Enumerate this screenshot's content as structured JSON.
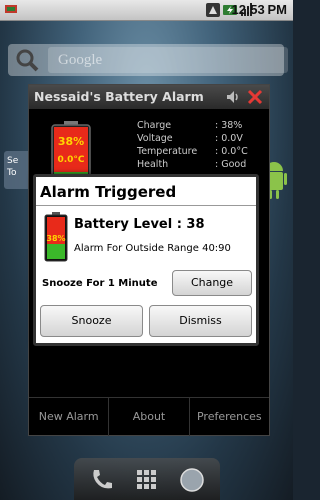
{
  "status_bar": {
    "time": "12:53",
    "time_suffix": "PM"
  },
  "home": {
    "search_placeholder": "Google",
    "side_widget_line1": "Se",
    "side_widget_line2": "To"
  },
  "app": {
    "title": "Nessaid's Battery Alarm",
    "battery_percent": "38%",
    "battery_temp": "0.0°C",
    "info": [
      {
        "key": "Charge",
        "value": ": 38%"
      },
      {
        "key": "Voltage",
        "value": ": 0.0V"
      },
      {
        "key": "Temperature",
        "value": ": 0.0°C"
      },
      {
        "key": "Health",
        "value": ": Good"
      }
    ],
    "footer": [
      "New Alarm",
      "About",
      "Preferences"
    ]
  },
  "alarm": {
    "title": "Alarm Triggered",
    "battery_percent": "38%",
    "level_text": "Battery Level : 38",
    "range_text": "Alarm For Outside Range 40:90",
    "snooze_label": "Snooze For 1 Minute",
    "change_label": "Change",
    "snooze_button": "Snooze",
    "dismiss_button": "Dismiss"
  },
  "colors": {
    "battery_red": "#e82a1a",
    "battery_green": "#3bb82a",
    "status_green": "#4caf50"
  },
  "icons": [
    "usb-icon",
    "notification-icon",
    "battery-charging-icon",
    "signal-icon",
    "search-icon",
    "android-icon",
    "phone-icon",
    "apps-icon",
    "browser-icon",
    "volume-icon",
    "close-icon"
  ]
}
